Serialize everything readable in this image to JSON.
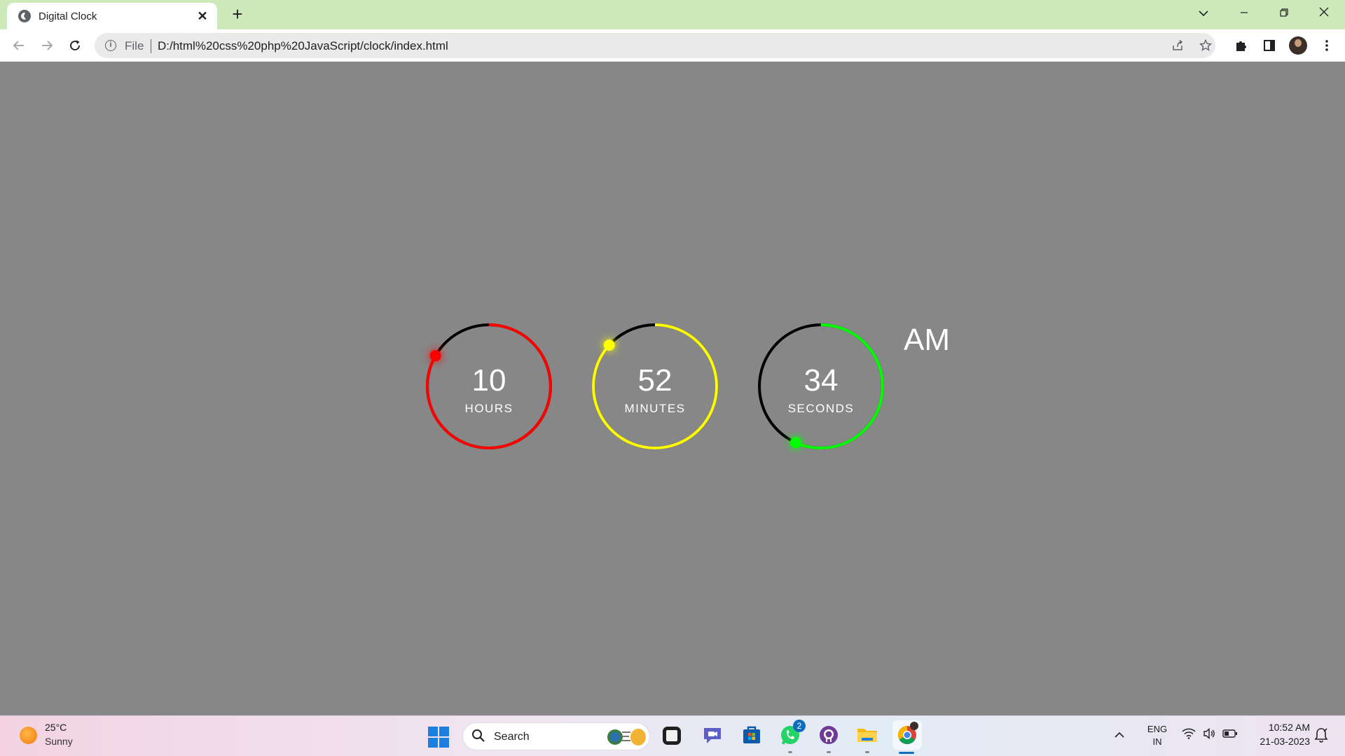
{
  "browser": {
    "tab_title": "Digital Clock",
    "tab_close": "✕",
    "new_tab": "+",
    "address_scheme": "File",
    "url": "D:/html%20css%20php%20JavaScript/clock/index.html",
    "window_controls": [
      "chevron-down-icon",
      "minimize-icon",
      "restore-icon",
      "close-icon"
    ]
  },
  "clock": {
    "hours": {
      "value": "10",
      "label": "HOURS",
      "fraction": 0.833,
      "color": "#ff0000"
    },
    "minutes": {
      "value": "52",
      "label": "MINUTES",
      "fraction": 0.867,
      "color": "#ffff00"
    },
    "seconds": {
      "value": "34",
      "label": "SECONDS",
      "fraction": 0.567,
      "color": "#00ff00"
    },
    "ampm": "AM",
    "track_color": "#000000"
  },
  "taskbar": {
    "weather_temp": "25°C",
    "weather_condition": "Sunny",
    "search_label": "Search",
    "whatsapp_badge": "2",
    "lang_line1": "ENG",
    "lang_line2": "IN",
    "time": "10:52 AM",
    "date": "21-03-2023"
  }
}
